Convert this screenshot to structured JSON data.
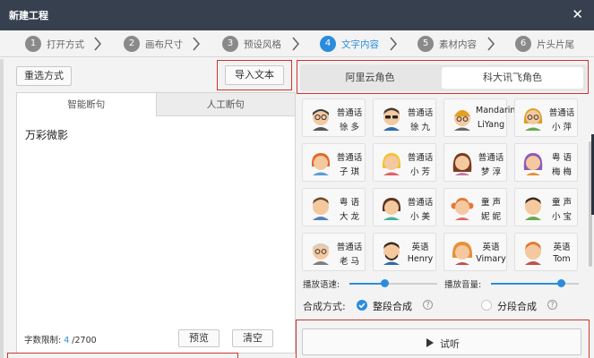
{
  "window": {
    "title": "新建工程",
    "close_glyph": "✕"
  },
  "steps": [
    {
      "num": "1",
      "label": "打开方式"
    },
    {
      "num": "2",
      "label": "画布尺寸"
    },
    {
      "num": "3",
      "label": "预设风格"
    },
    {
      "num": "4",
      "label": "文字内容",
      "active": true
    },
    {
      "num": "5",
      "label": "素材内容"
    },
    {
      "num": "6",
      "label": "片头片尾"
    }
  ],
  "left": {
    "reselect_label": "重选方式",
    "import_label": "导入文本",
    "tabs": [
      "智能断句",
      "人工断句"
    ],
    "text_value": "万彩微影",
    "limit_label": "字数限制: ",
    "limit_current": "4",
    "limit_max": " /2700",
    "preview_label": "预览",
    "clear_label": "清空"
  },
  "right": {
    "providers": [
      "阿里云角色",
      "科大讯飞角色"
    ],
    "selected_provider": "科大讯飞角色",
    "voices": [
      {
        "l1": "普通话",
        "l2": "徐 多",
        "avatar": "man-glasses-icon"
      },
      {
        "l1": "普通话",
        "l2": "徐 九",
        "avatar": "man-sunglasses-icon"
      },
      {
        "l1": "Mandarin",
        "l2": "LiYang",
        "avatar": "man-beanie-icon"
      },
      {
        "l1": "普通话",
        "l2": "小 萍",
        "avatar": "woman-glasses-icon"
      },
      {
        "l1": "普通话",
        "l2": "子 琪",
        "avatar": "girl-red-hair-icon"
      },
      {
        "l1": "普通话",
        "l2": "小 芳",
        "avatar": "girl-yellow-hair-icon"
      },
      {
        "l1": "普通话",
        "l2": "梦 淳",
        "avatar": "woman-long-hair-icon"
      },
      {
        "l1": "粤 语",
        "l2": "梅 梅",
        "avatar": "woman-purple-hair-icon"
      },
      {
        "l1": "粤 语",
        "l2": "大 龙",
        "avatar": "man-short-hair-icon"
      },
      {
        "l1": "普通话",
        "l2": "小 美",
        "avatar": "girl-bob-hair-icon"
      },
      {
        "l1": "童 声",
        "l2": "妮 妮",
        "avatar": "girl-pigtails-icon"
      },
      {
        "l1": "童 声",
        "l2": "小 宝",
        "avatar": "boy-green-icon"
      },
      {
        "l1": "普通话",
        "l2": "老 马",
        "avatar": "old-man-icon"
      },
      {
        "l1": "英语",
        "l2": "Henry",
        "avatar": "man-beard-icon"
      },
      {
        "l1": "英语",
        "l2": "Vimary",
        "avatar": "woman-curly-hair-icon"
      },
      {
        "l1": "英语",
        "l2": "Tom",
        "avatar": "boy-orange-hair-icon"
      }
    ],
    "speed_label": "播放语速:",
    "speed_value_pct": 40,
    "volume_label": "播放音量:",
    "volume_value_pct": 80,
    "mode_label": "合成方式:",
    "mode_whole": "整段合成",
    "mode_split": "分段合成",
    "selected_mode": "整段合成",
    "help_glyph": "?",
    "listen_label": "试听"
  },
  "colors": {
    "accent": "#2b8cde",
    "titlebar": "#37404e",
    "highlight_box": "#d0342c"
  }
}
